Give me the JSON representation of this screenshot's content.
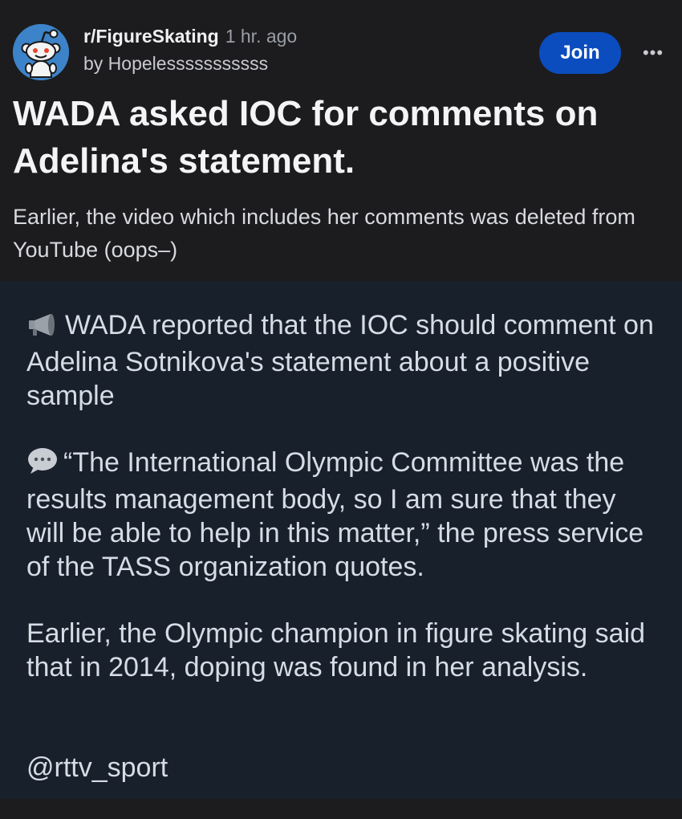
{
  "post": {
    "subreddit": "r/FigureSkating",
    "age": "1 hr. ago",
    "author": "by Hopelesssssssssss",
    "join_label": "Join",
    "more_label": "•••",
    "title": "WADA asked IOC for comments on Adelina's statement.",
    "body": "Earlier, the video which includes her comments was deleted from YouTube (oops–)"
  },
  "image": {
    "paragraph_1": "WADA reported that the IOC should comment on Adelina Sotnikova's statement about a positive sample",
    "paragraph_2": "“The International Olympic Committee was the results management body, so I am sure that they will be able to help in this matter,” the press service of the TASS organization quotes.",
    "paragraph_3": "Earlier, the Olympic champion in figure skating said that in 2014, doping was found in her analysis.",
    "paragraph_4": "@rttv_sport",
    "icons": [
      "megaphone-icon",
      "speech-bubble-icon"
    ]
  },
  "colors": {
    "background": "#1c1c1e",
    "image_background": "#18202c",
    "join_button": "#0b4dbf",
    "avatar": "#3d83c9"
  }
}
